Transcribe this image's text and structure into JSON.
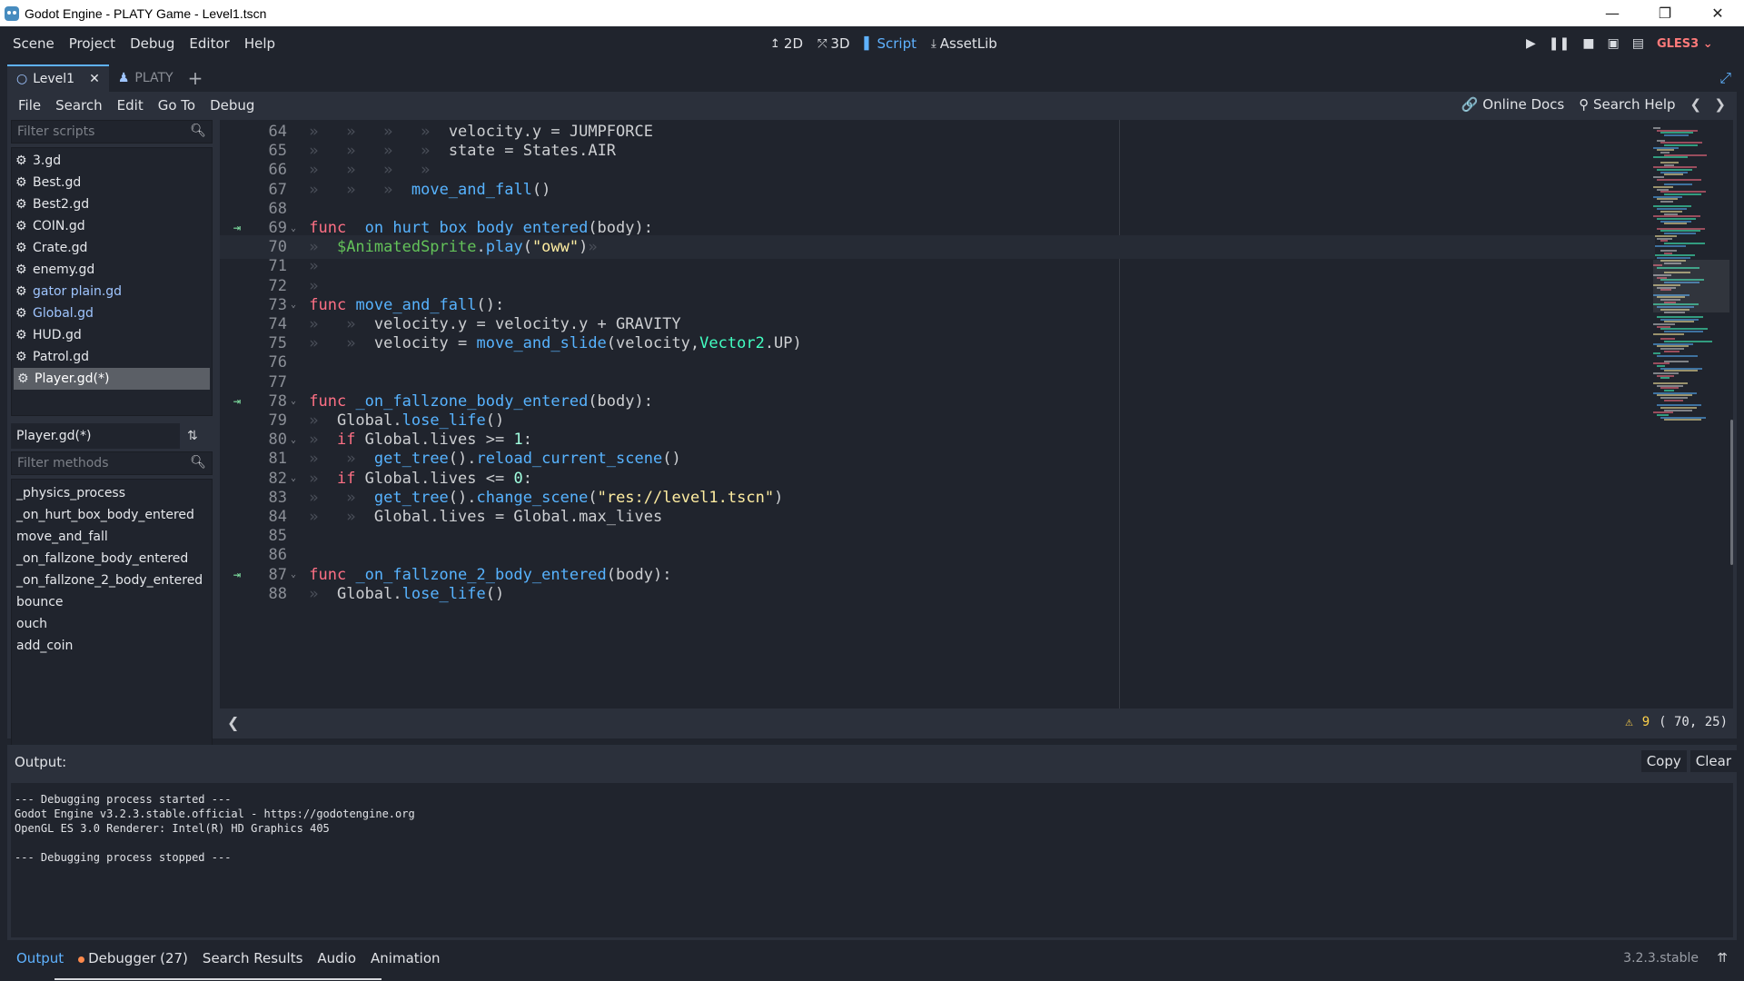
{
  "window": {
    "title": "Godot Engine - PLATY Game - Level1.tscn",
    "controls": [
      "—",
      "❐",
      "✕"
    ]
  },
  "main_menu": [
    "Scene",
    "Project",
    "Debug",
    "Editor",
    "Help"
  ],
  "workspaces": [
    {
      "icon": "2d-icon",
      "label": "2D",
      "glyph": "↥"
    },
    {
      "icon": "3d-icon",
      "label": "3D",
      "glyph": "⤱"
    },
    {
      "icon": "script-icon",
      "label": "Script",
      "glyph": "▌"
    },
    {
      "icon": "assetlib-icon",
      "label": "AssetLib",
      "glyph": "⤓"
    }
  ],
  "active_workspace": "Script",
  "renderer": "GLES3",
  "scene_tabs": [
    {
      "label": "Level1",
      "active": true
    },
    {
      "label": "PLATY",
      "active": false
    }
  ],
  "script_menu": [
    "File",
    "Search",
    "Edit",
    "Go To",
    "Debug"
  ],
  "help_links": {
    "online_docs": "Online Docs",
    "search_help": "Search Help"
  },
  "scripts_filter_placeholder": "Filter scripts",
  "scripts": [
    {
      "name": "3.gd",
      "style": "normal"
    },
    {
      "name": "Best.gd",
      "style": "normal"
    },
    {
      "name": "Best2.gd",
      "style": "normal"
    },
    {
      "name": "COIN.gd",
      "style": "normal"
    },
    {
      "name": "Crate.gd",
      "style": "normal"
    },
    {
      "name": "enemy.gd",
      "style": "normal"
    },
    {
      "name": "gator plain.gd",
      "style": "blue"
    },
    {
      "name": "Global.gd",
      "style": "blue"
    },
    {
      "name": "HUD.gd",
      "style": "normal"
    },
    {
      "name": "Patrol.gd",
      "style": "normal"
    },
    {
      "name": "Player.gd(*)",
      "style": "selected"
    }
  ],
  "current_script": "Player.gd(*)",
  "methods_filter_placeholder": "Filter methods",
  "methods": [
    "_physics_process",
    "_on_hurt_box_body_entered",
    "move_and_fall",
    "_on_fallzone_body_entered",
    "_on_fallzone_2_body_entered",
    "bounce",
    "ouch",
    "add_coin"
  ],
  "code_lines": [
    {
      "n": 64,
      "fold": false,
      "bp": false,
      "current": false,
      "tabs": 4,
      "tokens": [
        [
          "id",
          "velocity.y = JUMPFORCE"
        ]
      ]
    },
    {
      "n": 65,
      "fold": false,
      "bp": false,
      "current": false,
      "tabs": 4,
      "tokens": [
        [
          "id",
          "state = States.AIR"
        ]
      ]
    },
    {
      "n": 66,
      "fold": false,
      "bp": false,
      "current": false,
      "tabs": 4,
      "tokens": []
    },
    {
      "n": 67,
      "fold": false,
      "bp": false,
      "current": false,
      "tabs": 3,
      "tokens": [
        [
          "fn",
          "move_and_fall"
        ],
        [
          "id",
          "()"
        ]
      ]
    },
    {
      "n": 68,
      "fold": false,
      "bp": false,
      "current": false,
      "tabs": 0,
      "tokens": []
    },
    {
      "n": 69,
      "fold": true,
      "bp": true,
      "current": false,
      "tabs": 0,
      "tokens": [
        [
          "kw",
          "func "
        ],
        [
          "fnd",
          "_on_hurt_box_body_entered"
        ],
        [
          "id",
          "(body):"
        ]
      ]
    },
    {
      "n": 70,
      "fold": false,
      "bp": false,
      "current": true,
      "tabs": 1,
      "tokens": [
        [
          "node",
          "$AnimatedSprite"
        ],
        [
          "id",
          "."
        ],
        [
          "fn",
          "play"
        ],
        [
          "id",
          "("
        ],
        [
          "str",
          "\"oww\""
        ],
        [
          "id",
          ")"
        ],
        [
          "tab",
          "»"
        ]
      ]
    },
    {
      "n": 71,
      "fold": false,
      "bp": false,
      "current": false,
      "tabs": 1,
      "tokens": []
    },
    {
      "n": 72,
      "fold": false,
      "bp": false,
      "current": false,
      "tabs": 1,
      "tokens": []
    },
    {
      "n": 73,
      "fold": true,
      "bp": false,
      "current": false,
      "tabs": 0,
      "tokens": [
        [
          "kw",
          "func "
        ],
        [
          "fnd",
          "move_and_fall"
        ],
        [
          "id",
          "():"
        ]
      ]
    },
    {
      "n": 74,
      "fold": false,
      "bp": false,
      "current": false,
      "tabs": 2,
      "tokens": [
        [
          "id",
          "velocity.y = velocity.y + GRAVITY"
        ]
      ]
    },
    {
      "n": 75,
      "fold": false,
      "bp": false,
      "current": false,
      "tabs": 2,
      "tokens": [
        [
          "id",
          "velocity = "
        ],
        [
          "fn",
          "move_and_slide"
        ],
        [
          "id",
          "(velocity,"
        ],
        [
          "ty",
          "Vector2"
        ],
        [
          "id",
          ".UP)"
        ]
      ]
    },
    {
      "n": 76,
      "fold": false,
      "bp": false,
      "current": false,
      "tabs": 0,
      "tokens": []
    },
    {
      "n": 77,
      "fold": false,
      "bp": false,
      "current": false,
      "tabs": 0,
      "tokens": []
    },
    {
      "n": 78,
      "fold": true,
      "bp": true,
      "current": false,
      "tabs": 0,
      "tokens": [
        [
          "kw",
          "func "
        ],
        [
          "fnd",
          "_on_fallzone_body_entered"
        ],
        [
          "id",
          "(body):"
        ]
      ]
    },
    {
      "n": 79,
      "fold": false,
      "bp": false,
      "current": false,
      "tabs": 1,
      "tokens": [
        [
          "id",
          "Global."
        ],
        [
          "fn",
          "lose_life"
        ],
        [
          "id",
          "()"
        ]
      ]
    },
    {
      "n": 80,
      "fold": true,
      "bp": false,
      "current": false,
      "tabs": 1,
      "tokens": [
        [
          "kw",
          "if "
        ],
        [
          "id",
          "Global.lives >= "
        ],
        [
          "num",
          "1"
        ],
        [
          "id",
          ":"
        ]
      ]
    },
    {
      "n": 81,
      "fold": false,
      "bp": false,
      "current": false,
      "tabs": 2,
      "tokens": [
        [
          "fn",
          "get_tree"
        ],
        [
          "id",
          "()."
        ],
        [
          "fn",
          "reload_current_scene"
        ],
        [
          "id",
          "()"
        ]
      ]
    },
    {
      "n": 82,
      "fold": true,
      "bp": false,
      "current": false,
      "tabs": 1,
      "tokens": [
        [
          "kw",
          "if "
        ],
        [
          "id",
          "Global.lives <= "
        ],
        [
          "num",
          "0"
        ],
        [
          "id",
          ":"
        ]
      ]
    },
    {
      "n": 83,
      "fold": false,
      "bp": false,
      "current": false,
      "tabs": 2,
      "tokens": [
        [
          "fn",
          "get_tree"
        ],
        [
          "id",
          "()."
        ],
        [
          "fn",
          "change_scene"
        ],
        [
          "id",
          "("
        ],
        [
          "str",
          "\"res://level1.tscn\""
        ],
        [
          "id",
          ")"
        ]
      ]
    },
    {
      "n": 84,
      "fold": false,
      "bp": false,
      "current": false,
      "tabs": 2,
      "tokens": [
        [
          "id",
          "Global.lives = Global.max_lives"
        ]
      ]
    },
    {
      "n": 85,
      "fold": false,
      "bp": false,
      "current": false,
      "tabs": 0,
      "tokens": []
    },
    {
      "n": 86,
      "fold": false,
      "bp": false,
      "current": false,
      "tabs": 0,
      "tokens": []
    },
    {
      "n": 87,
      "fold": true,
      "bp": true,
      "current": false,
      "tabs": 0,
      "tokens": [
        [
          "kw",
          "func "
        ],
        [
          "fnd",
          "_on_fallzone_2_body_entered"
        ],
        [
          "id",
          "(body):"
        ]
      ]
    },
    {
      "n": 88,
      "fold": false,
      "bp": false,
      "current": false,
      "tabs": 1,
      "tokens": [
        [
          "id",
          "Global."
        ],
        [
          "fn",
          "lose_life"
        ],
        [
          "id",
          "()"
        ]
      ]
    }
  ],
  "status": {
    "warnings": "9",
    "cursor": "( 70, 25)"
  },
  "output": {
    "label": "Output:",
    "copy": "Copy",
    "clear": "Clear",
    "log": "--- Debugging process started ---\nGodot Engine v3.2.3.stable.official - https://godotengine.org\nOpenGL ES 3.0 Renderer: Intel(R) HD Graphics 405\n\n--- Debugging process stopped ---"
  },
  "bottom_tabs": [
    {
      "label": "Output",
      "active": true,
      "dot": false
    },
    {
      "label": "Debugger (27)",
      "active": false,
      "dot": true
    },
    {
      "label": "Search Results",
      "active": false,
      "dot": false
    },
    {
      "label": "Audio",
      "active": false,
      "dot": false
    },
    {
      "label": "Animation",
      "active": false,
      "dot": false
    }
  ],
  "version": "3.2.3.stable",
  "colors": {
    "accent": "#5fb2ff",
    "keyword": "#ff7085",
    "function": "#57b3ff",
    "string": "#ffeda1",
    "warning": "#ffd24a",
    "renderer": "#ff7a7a"
  }
}
